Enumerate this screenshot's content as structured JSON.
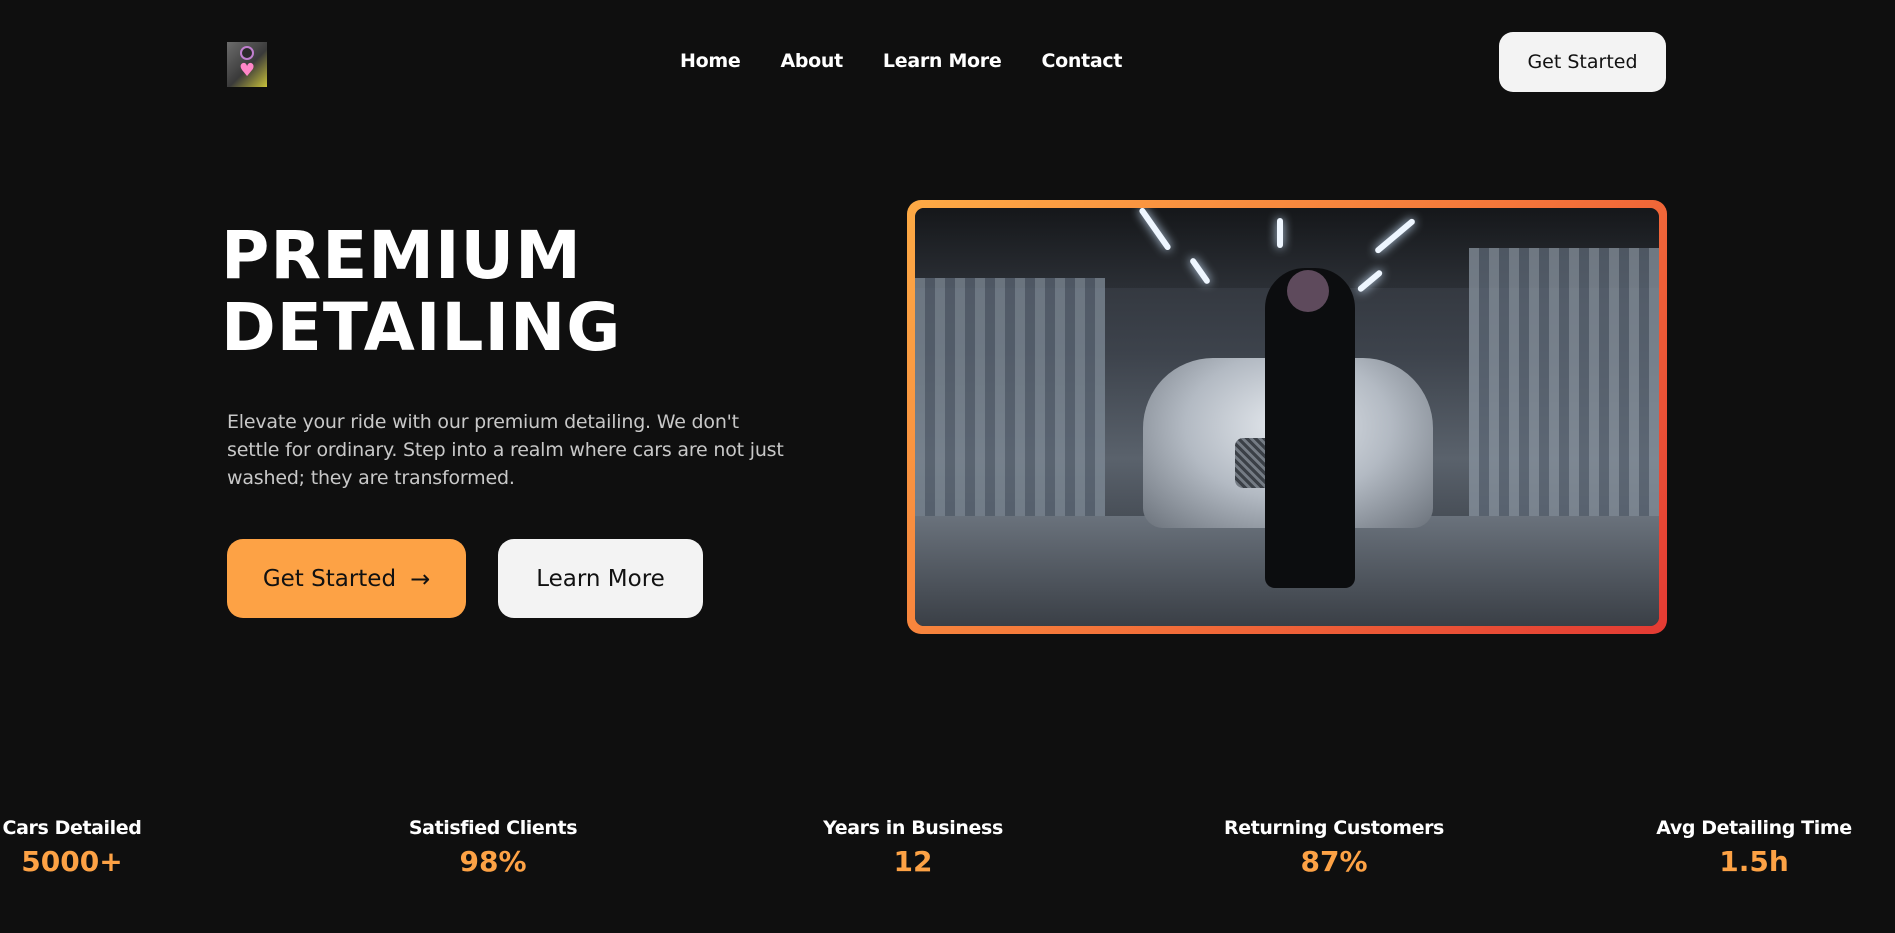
{
  "nav": {
    "logo_alt": "site logo",
    "links": [
      "Home",
      "About",
      "Learn More",
      "Contact"
    ],
    "cta_label": "Get Started"
  },
  "hero": {
    "title_line1": "PREMIUM",
    "title_line2": "DETAILING",
    "description": "Elevate your ride with our premium detailing. We don't settle for ordinary. Step into a realm where cars are not just washed; they are transformed.",
    "primary_label": "Get Started",
    "primary_icon": "arrow-right-icon",
    "secondary_label": "Learn More",
    "frame_gradient": [
      "#fdaa45",
      "#f5773a",
      "#e33a33"
    ]
  },
  "stats": [
    {
      "label": "Cars Detailed",
      "value": "5000+"
    },
    {
      "label": "Satisfied Clients",
      "value": "98%"
    },
    {
      "label": "Years in Business",
      "value": "12"
    },
    {
      "label": "Returning Customers",
      "value": "87%"
    },
    {
      "label": "Avg Detailing Time",
      "value": "1.5h"
    }
  ],
  "colors": {
    "background": "#0f0f0f",
    "accent": "#fda245",
    "button_light": "#f3f3f3",
    "text_muted": "#c8c8c8"
  }
}
